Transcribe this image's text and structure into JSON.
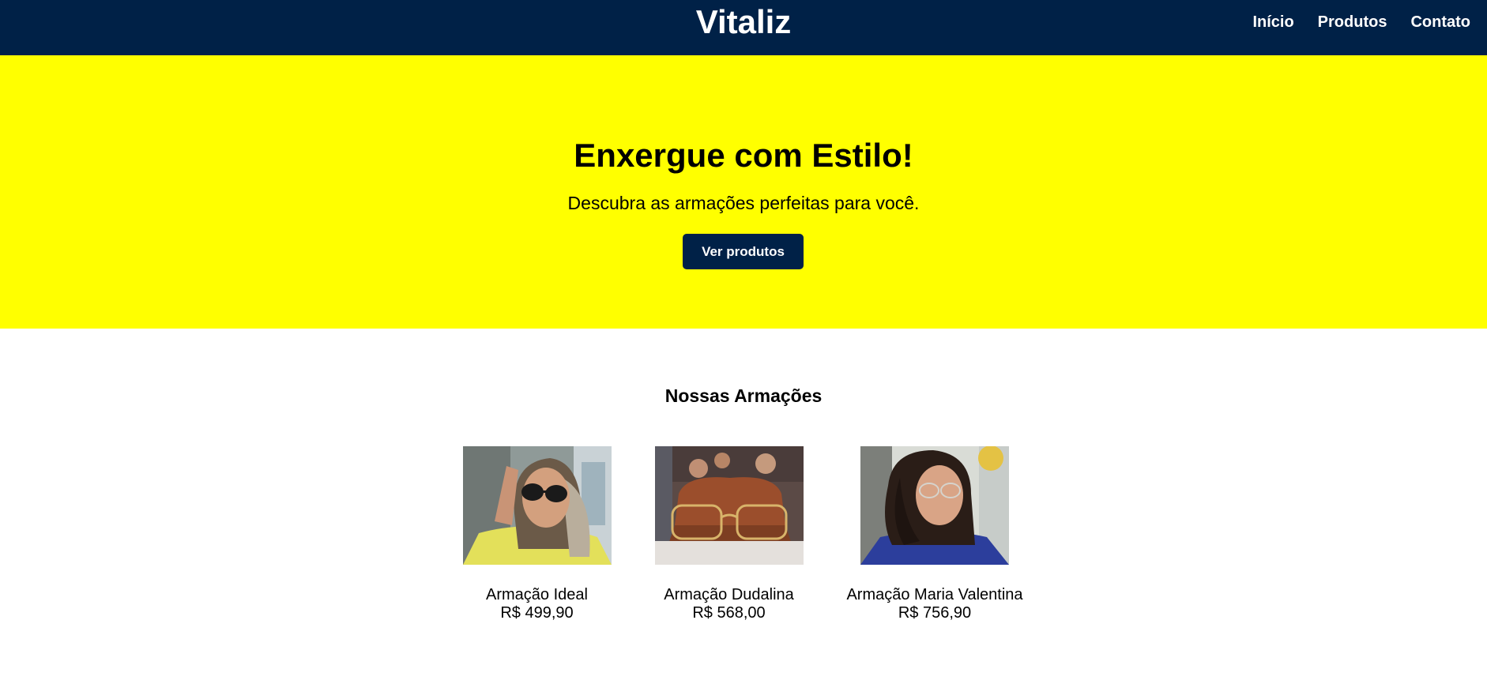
{
  "header": {
    "brand": "Vitaliz",
    "nav": [
      "Início",
      "Produtos",
      "Contato"
    ]
  },
  "hero": {
    "title": "Enxergue com Estilo!",
    "subtitle": "Descubra as armações perfeitas para você.",
    "button": "Ver produtos"
  },
  "products": {
    "title": "Nossas Armações",
    "items": [
      {
        "name": "Armação Ideal",
        "price": "R$ 499,90",
        "photo": "woman-yellow-shirt-sunglasses"
      },
      {
        "name": "Armação Dudalina",
        "price": "R$ 568,00",
        "photo": "glasses-on-brown-case"
      },
      {
        "name": "Armação Maria Valentina",
        "price": "R$ 756,90",
        "photo": "woman-curly-hair-glasses"
      }
    ]
  },
  "colors": {
    "header_bg": "#002147",
    "hero_bg": "#ffff00",
    "button_bg": "#002147"
  }
}
